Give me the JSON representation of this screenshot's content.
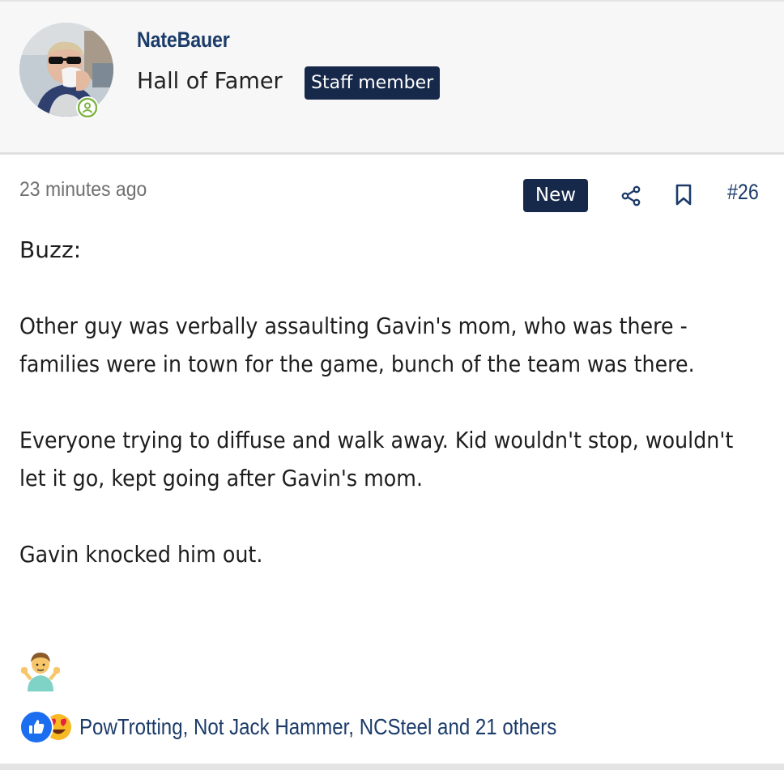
{
  "user": {
    "username": "NateBauer",
    "title": "Hall of Famer",
    "badge": "Staff member",
    "avatar_icon": "user-avatar-photo",
    "status_icon": "online-status-icon"
  },
  "post": {
    "time": "23 minutes ago",
    "new_label": "New",
    "number": "#26",
    "share_icon": "share-icon",
    "bookmark_icon": "bookmark-icon",
    "paragraphs": [
      "Buzz:",
      "Other guy was verbally assaulting Gavin's mom, who was there - families were in town for the game, bunch of the team was there.",
      "Everyone trying to diffuse and walk away. Kid wouldn't stop, wouldn't let it go, kept going after Gavin's mom.",
      "Gavin knocked him out."
    ],
    "emoji": "person-shrugging-emoji"
  },
  "reactions": {
    "icons": [
      "like-icon",
      "love-icon"
    ],
    "users_text": "PowTrotting, Not Jack Hammer, NCSteel and 21 others"
  },
  "colors": {
    "badge_bg": "#17294a",
    "link": "#1b3b69",
    "header_bg": "#f7f7f7",
    "online": "#7cb342"
  }
}
